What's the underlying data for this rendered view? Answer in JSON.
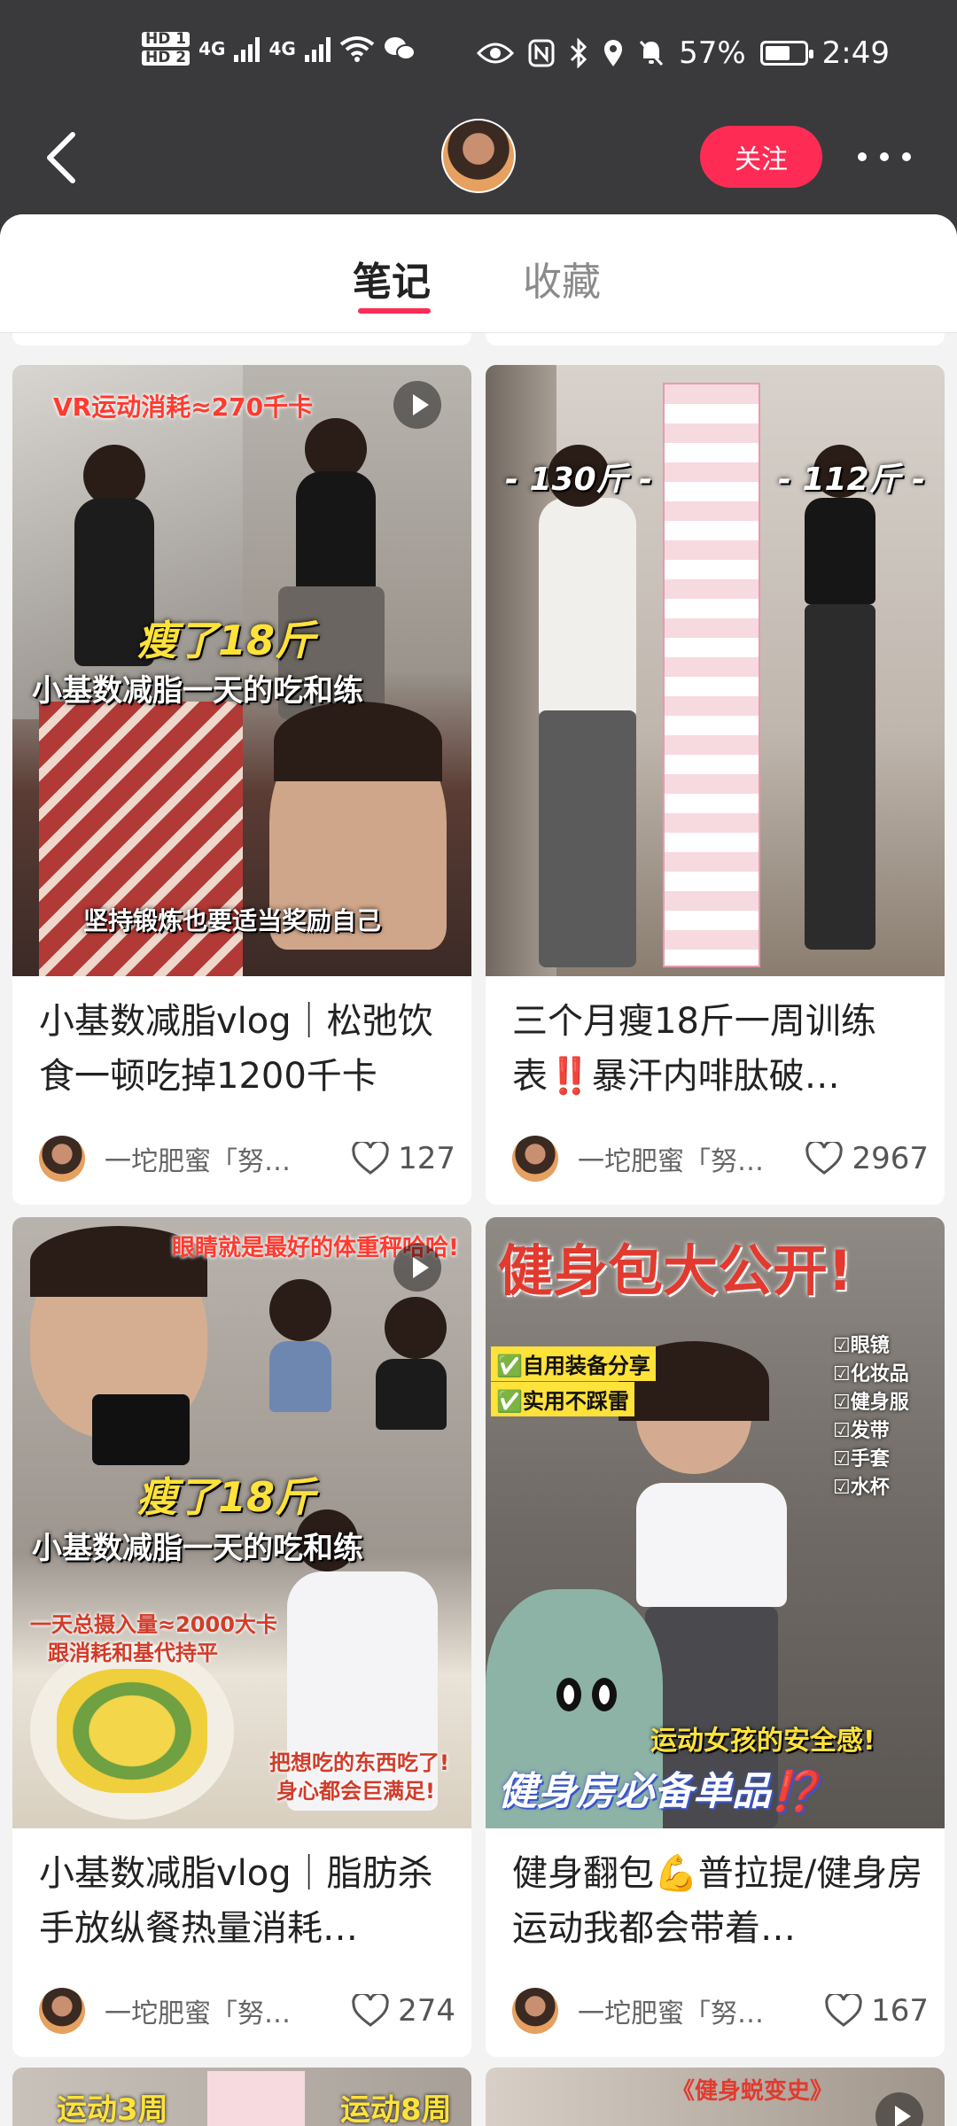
{
  "status_bar": {
    "hd1": "HD 1",
    "hd2": "HD 2",
    "net1": "4G",
    "net2": "4G",
    "battery": "57%",
    "time": "2:49"
  },
  "header": {
    "follow_label": "关注"
  },
  "tabs": [
    {
      "label": "笔记",
      "active": true
    },
    {
      "label": "收藏",
      "active": false
    }
  ],
  "notes": [
    {
      "caption": "小基数减脂vlog｜松弛饮食一顿吃掉1200千卡",
      "author": "一坨肥蜜「努…",
      "likes": "127",
      "overlay": {
        "top": "VR运动消耗≈270千卡",
        "big": "瘦了18斤",
        "sub": "小基数减脂一天的吃和练",
        "bottom": "坚持锻炼也要适当奖励自己"
      }
    },
    {
      "caption": "三个月瘦18斤一周训练表‼️暴汗内啡肽破…",
      "author": "一坨肥蜜「努…",
      "likes": "2967",
      "overlay": {
        "left": "- 130斤 -",
        "right": "- 112斤 -"
      }
    },
    {
      "caption": "小基数减脂vlog｜脂肪杀手放纵餐热量消耗…",
      "author": "一坨肥蜜「努…",
      "likes": "274",
      "overlay": {
        "top": "眼睛就是最好的体重秤哈哈!",
        "big": "瘦了18斤",
        "sub": "小基数减脂一天的吃和练",
        "left1": "一天总摄入量≈2000大卡",
        "left2": "跟消耗和基代持平",
        "right1": "把想吃的东西吃了!",
        "right2": "身心都会巨满足!"
      }
    },
    {
      "caption": "健身翻包💪普拉提/健身房运动我都会带着…",
      "author": "一坨肥蜜「努…",
      "likes": "167",
      "overlay": {
        "title": "健身包大公开!",
        "tag1": "✅自用装备分享",
        "tag2": "✅实用不踩雷",
        "list": [
          "☑眼镜",
          "☑化妆品",
          "☑健身服",
          "☑发带",
          "☑手套",
          "☑水杯"
        ],
        "bottom1": "运动女孩的安全感!",
        "bottom2": "健身房必备单品⁉️"
      }
    }
  ],
  "partial": {
    "left": "运动3周",
    "right": "运动8周",
    "right_title": "《健身蜕变史》"
  },
  "colors": {
    "accent": "#fe2c55",
    "header_bg": "#3a3a3c"
  }
}
